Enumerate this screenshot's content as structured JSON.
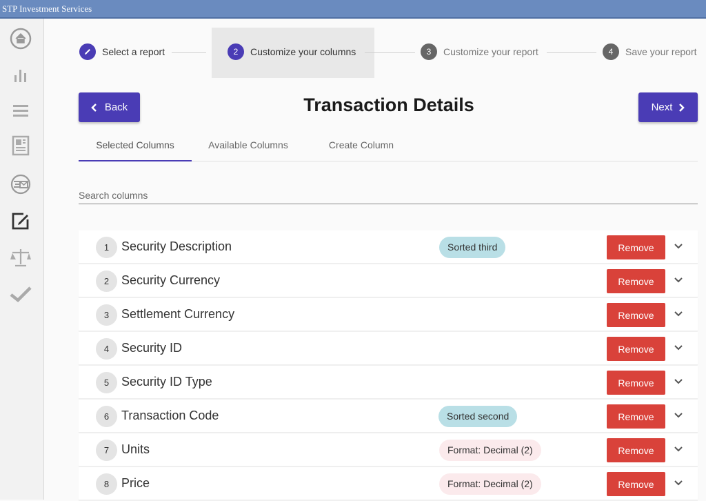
{
  "window": {
    "title": "STP Investment Services"
  },
  "sidebar": {
    "items": [
      {
        "icon": "home-icon",
        "active": false
      },
      {
        "icon": "bar-chart-icon",
        "active": false
      },
      {
        "icon": "menu-lines-icon",
        "active": false
      },
      {
        "icon": "document-icon",
        "active": false
      },
      {
        "icon": "money-transfer-icon",
        "active": false
      },
      {
        "icon": "edit-icon",
        "active": true
      },
      {
        "icon": "scale-icon",
        "active": false
      },
      {
        "icon": "checkmark-icon",
        "active": false
      }
    ]
  },
  "stepper": {
    "steps": [
      {
        "number": "1",
        "label": "Select a report",
        "state": "completed",
        "icon": "pencil-icon"
      },
      {
        "number": "2",
        "label": "Customize your columns",
        "state": "active"
      },
      {
        "number": "3",
        "label": "Customize your report",
        "state": "pending"
      },
      {
        "number": "4",
        "label": "Save your report",
        "state": "pending"
      }
    ]
  },
  "header": {
    "back_label": "Back",
    "title": "Transaction Details",
    "next_label": "Next"
  },
  "tabs": [
    {
      "label": "Selected Columns",
      "active": true
    },
    {
      "label": "Available Columns",
      "active": false
    },
    {
      "label": "Create Column",
      "active": false
    }
  ],
  "search": {
    "placeholder": "Search columns",
    "value": ""
  },
  "columns": [
    {
      "index": "1",
      "name": "Security Description",
      "badge": "Sorted third",
      "badge_type": "sort",
      "remove_label": "Remove"
    },
    {
      "index": "2",
      "name": "Security Currency",
      "badge": null,
      "badge_type": null,
      "remove_label": "Remove"
    },
    {
      "index": "3",
      "name": "Settlement Currency",
      "badge": null,
      "badge_type": null,
      "remove_label": "Remove"
    },
    {
      "index": "4",
      "name": "Security ID",
      "badge": null,
      "badge_type": null,
      "remove_label": "Remove"
    },
    {
      "index": "5",
      "name": "Security ID Type",
      "badge": null,
      "badge_type": null,
      "remove_label": "Remove"
    },
    {
      "index": "6",
      "name": "Transaction Code",
      "badge": "Sorted second",
      "badge_type": "sort",
      "remove_label": "Remove"
    },
    {
      "index": "7",
      "name": "Units",
      "badge": "Format: Decimal (2)",
      "badge_type": "fmt",
      "remove_label": "Remove"
    },
    {
      "index": "8",
      "name": "Price",
      "badge": "Format: Decimal (2)",
      "badge_type": "fmt",
      "remove_label": "Remove"
    }
  ],
  "colors": {
    "primary": "#4a3cb5",
    "danger": "#d9423a",
    "titlebar": "#6a8bbf",
    "sort_badge": "#b9dfe6",
    "format_badge": "#fbeaec"
  }
}
